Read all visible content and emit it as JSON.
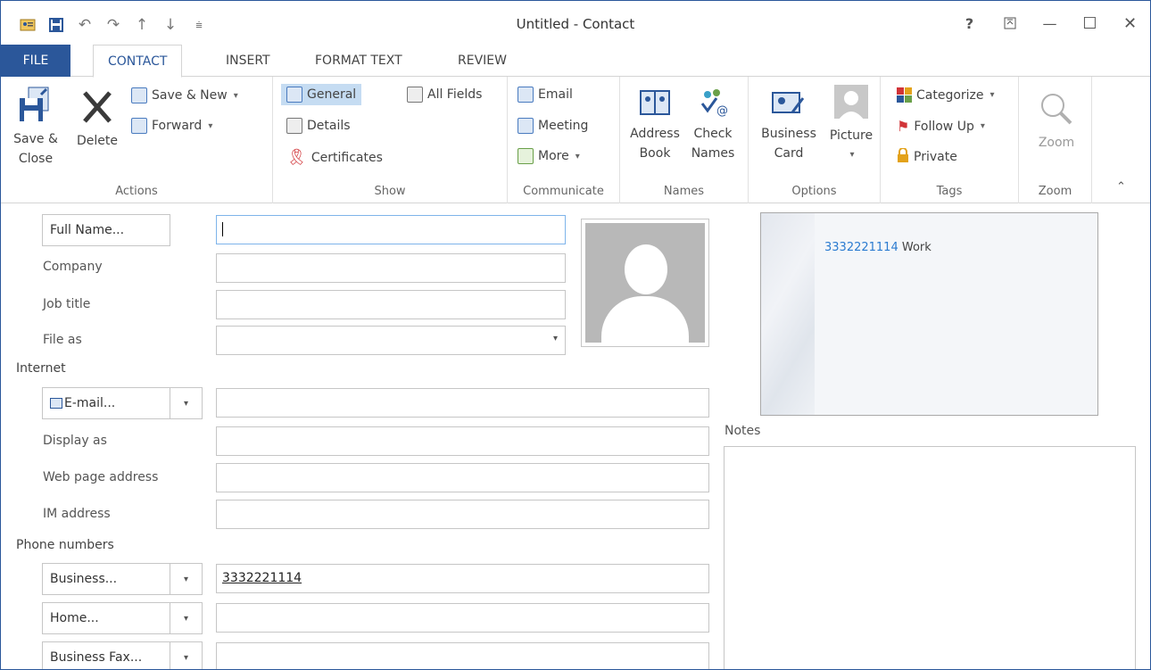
{
  "window": {
    "title": "Untitled - Contact"
  },
  "qat": {
    "icons": [
      "contact-icon",
      "save-icon",
      "undo-icon",
      "redo-icon",
      "up-arrow-icon",
      "down-arrow-icon",
      "customize-icon"
    ]
  },
  "window_controls": {
    "help": "?",
    "ribbon_display": "⊼",
    "minimize": "—",
    "maximize": "☐",
    "close": "✕"
  },
  "tabs": [
    {
      "label": "FILE"
    },
    {
      "label": "CONTACT"
    },
    {
      "label": "INSERT"
    },
    {
      "label": "FORMAT TEXT"
    },
    {
      "label": "REVIEW"
    }
  ],
  "ribbon": {
    "actions": {
      "label": "Actions",
      "save_close": "Save &",
      "save_close_2": "Close",
      "delete": "Delete",
      "save_new": "Save & New",
      "forward": "Forward"
    },
    "show": {
      "label": "Show",
      "general": "General",
      "all_fields": "All Fields",
      "details": "Details",
      "certificates": "Certificates"
    },
    "communicate": {
      "label": "Communicate",
      "email": "Email",
      "meeting": "Meeting",
      "more": "More"
    },
    "names": {
      "label": "Names",
      "address_book_1": "Address",
      "address_book_2": "Book",
      "check_names_1": "Check",
      "check_names_2": "Names"
    },
    "options": {
      "label": "Options",
      "business_card_1": "Business",
      "business_card_2": "Card",
      "picture": "Picture"
    },
    "tags": {
      "label": "Tags",
      "categorize": "Categorize",
      "follow_up": "Follow Up",
      "private": "Private"
    },
    "zoom": {
      "label": "Zoom",
      "zoom": "Zoom"
    }
  },
  "form": {
    "full_name_button": "Full Name...",
    "full_name_value": "",
    "company_label": "Company",
    "job_title_label": "Job title",
    "file_as_label": "File as",
    "internet_section": "Internet",
    "email_button": "E-mail...",
    "display_as_label": "Display as",
    "web_page_label": "Web page address",
    "im_address_label": "IM address",
    "phone_section": "Phone numbers",
    "business_button": "Business...",
    "business_value": "3332221114",
    "home_button": "Home...",
    "business_fax_button": "Business Fax..."
  },
  "business_card": {
    "phone": "3332221114",
    "phone_type": "Work"
  },
  "notes": {
    "label": "Notes"
  },
  "colors": {
    "accent": "#2b579a",
    "link": "#2b7bd0"
  }
}
